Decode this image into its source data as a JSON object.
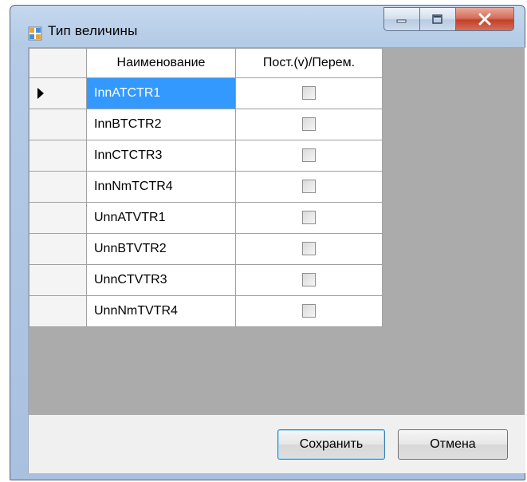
{
  "window": {
    "title": "Тип величины"
  },
  "grid": {
    "columns": [
      "Наименование",
      "Пост.(v)/Перем."
    ],
    "rows": [
      {
        "name": "InnATCTR1",
        "checked": false,
        "selected": true
      },
      {
        "name": "InnBTCTR2",
        "checked": false
      },
      {
        "name": "InnCTCTR3",
        "checked": false
      },
      {
        "name": "InnNmTCTR4",
        "checked": false
      },
      {
        "name": "UnnATVTR1",
        "checked": false
      },
      {
        "name": "UnnBTVTR2",
        "checked": false
      },
      {
        "name": "UnnCTVTR3",
        "checked": false
      },
      {
        "name": "UnnNmTVTR4",
        "checked": false
      }
    ]
  },
  "buttons": {
    "save": "Сохранить",
    "cancel": "Отмена"
  },
  "colors": {
    "selection": "#3399ff",
    "grid_background": "#ababab",
    "close_button": "#c2402a"
  }
}
